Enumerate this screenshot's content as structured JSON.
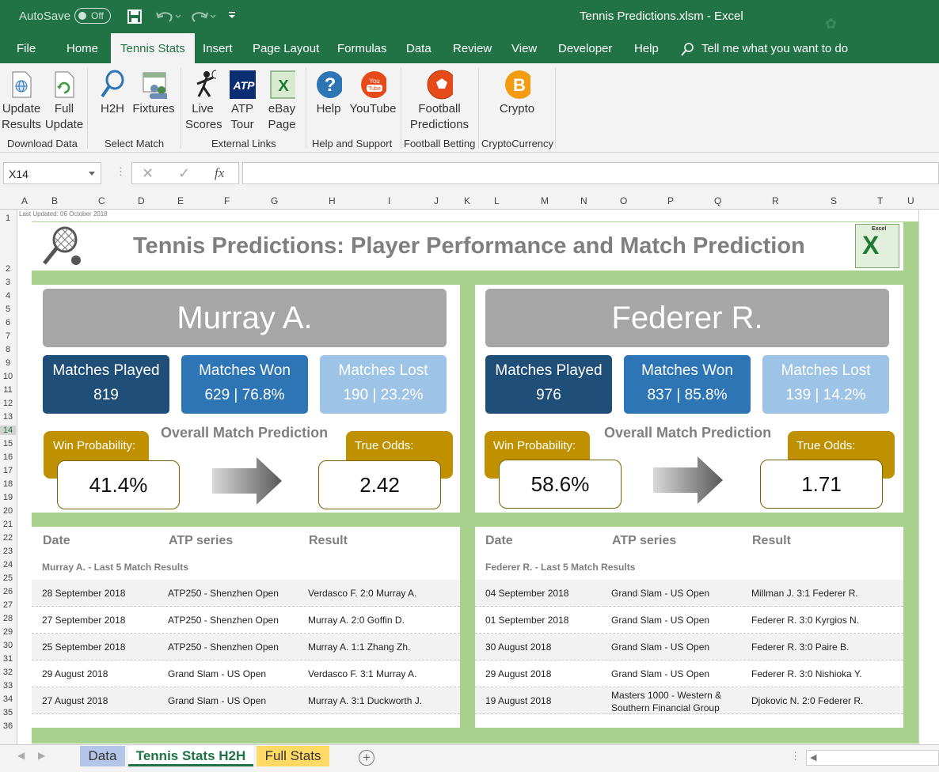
{
  "titlebar": {
    "autosave": "AutoSave",
    "toggle": "Off",
    "title": "Tennis Predictions.xlsm  -  Excel"
  },
  "menu": {
    "file": "File",
    "home": "Home",
    "tennis": "Tennis Stats",
    "insert": "Insert",
    "layout": "Page Layout",
    "formulas": "Formulas",
    "data": "Data",
    "review": "Review",
    "view": "View",
    "developer": "Developer",
    "help": "Help",
    "tell": "Tell me what you want to do"
  },
  "ribbon": {
    "update_a": "Update",
    "update_b": "Results",
    "full_a": "Full",
    "full_b": "Update",
    "grp_download": "Download Data",
    "h2h": "H2H",
    "fixtures": "Fixtures",
    "grp_select": "Select Match",
    "live_a": "Live",
    "live_b": "Scores",
    "atp_a": "ATP",
    "atp_b": "Tour",
    "ebay_a": "eBay",
    "ebay_b": "Page",
    "grp_links": "External Links",
    "help": "Help",
    "youtube": "YouTube",
    "grp_support": "Help and Support",
    "football_a": "Football",
    "football_b": "Predictions",
    "grp_football": "Football Betting",
    "crypto": "Crypto",
    "grp_crypto": "CryptoCurrency"
  },
  "formula": {
    "namebox": "X14",
    "fx": "fx",
    "cancel": "✕",
    "enter": "✓"
  },
  "columns": [
    "A",
    "B",
    "C",
    "D",
    "E",
    "F",
    "G",
    "H",
    "I",
    "J",
    "K",
    "L",
    "M",
    "N",
    "O",
    "P",
    "Q",
    "R",
    "S",
    "T",
    "U"
  ],
  "rows": [
    "1",
    "2",
    "3",
    "4",
    "5",
    "6",
    "7",
    "8",
    "9",
    "10",
    "11",
    "12",
    "13",
    "14",
    "15",
    "16",
    "17",
    "18",
    "19",
    "20",
    "21",
    "22",
    "23",
    "24",
    "25",
    "26",
    "27",
    "28",
    "29",
    "30",
    "31",
    "32",
    "33",
    "34",
    "35",
    "36"
  ],
  "sheet": {
    "last_updated": "Last Updated: 06 October 2018",
    "title": "Tennis Predictions: Player Performance and Match Prediction",
    "logo_text": "Excel"
  },
  "labels": {
    "played": "Matches Played",
    "won": "Matches Won",
    "lost": "Matches Lost",
    "win_prob": "Win Probability:",
    "true_odds": "True Odds:",
    "omp": "Overall Match Prediction",
    "date": "Date",
    "series": "ATP series",
    "result": "Result"
  },
  "p1": {
    "name": "Murray A.",
    "played": "819",
    "won": "629 | 76.8%",
    "lost": "190 | 23.2%",
    "prob": "41.4%",
    "odds": "2.42",
    "sub": "Murray A. - Last 5 Match Results",
    "matches": [
      {
        "date": "28 September 2018",
        "series": "ATP250 - Shenzhen Open",
        "result": "Verdasco F. 2:0 Murray A."
      },
      {
        "date": "27 September 2018",
        "series": "ATP250 - Shenzhen Open",
        "result": "Murray A. 2:0 Goffin D."
      },
      {
        "date": "25 September 2018",
        "series": "ATP250 - Shenzhen Open",
        "result": "Murray A. 1:1 Zhang Zh."
      },
      {
        "date": "29 August 2018",
        "series": "Grand Slam - US Open",
        "result": "Verdasco F. 3:1 Murray A."
      },
      {
        "date": "27 August 2018",
        "series": "Grand Slam - US Open",
        "result": "Murray A. 3:1 Duckworth J."
      }
    ]
  },
  "p2": {
    "name": "Federer R.",
    "played": "976",
    "won": "837 | 85.8%",
    "lost": "139 | 14.2%",
    "prob": "58.6%",
    "odds": "1.71",
    "sub": "Federer R. - Last 5 Match Results",
    "matches": [
      {
        "date": "04 September 2018",
        "series": "Grand Slam - US Open",
        "result": "Millman J. 3:1 Federer R."
      },
      {
        "date": "01 September 2018",
        "series": "Grand Slam - US Open",
        "result": "Federer R. 3:0 Kyrgios N."
      },
      {
        "date": "30 August 2018",
        "series": "Grand Slam - US Open",
        "result": "Federer R. 3:0 Paire B."
      },
      {
        "date": "29 August 2018",
        "series": "Grand Slam - US Open",
        "result": "Federer R. 3:0 Nishioka Y."
      },
      {
        "date": "19 August 2018",
        "series": "Masters 1000 - Western & Southern Financial Group",
        "result": "Djokovic N. 2:0 Federer R."
      }
    ]
  },
  "tabs": {
    "data": "Data",
    "h2h": "Tennis Stats H2H",
    "full": "Full Stats",
    "add": "+"
  },
  "colors": {
    "excel_green": "#217346",
    "sheet_green": "#a9d18e",
    "dark_blue": "#1f4e79",
    "mid_blue": "#2e75b6",
    "light_blue": "#9dc3e6",
    "gold": "#bf9000"
  }
}
